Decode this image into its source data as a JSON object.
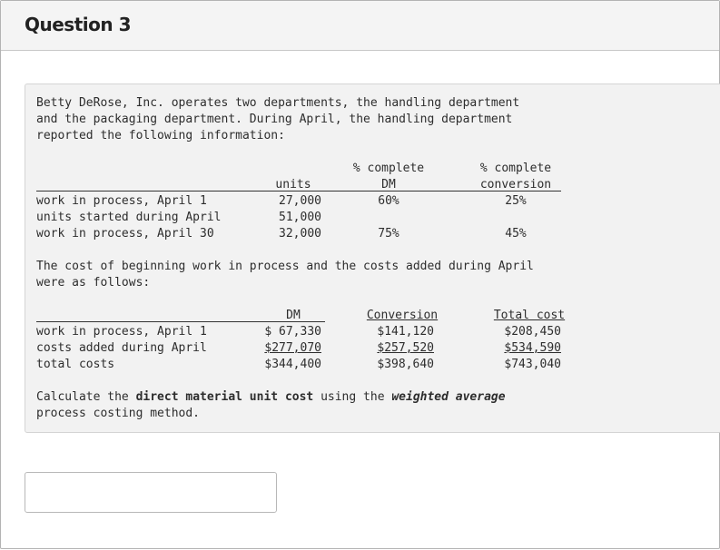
{
  "question": {
    "title": "Question 3"
  },
  "intro": [
    "Betty DeRose, Inc. operates two departments, the handling department",
    "and the packaging department. During April, the handling department",
    "reported the following information:"
  ],
  "units_table": {
    "headers": {
      "units": "units",
      "dm_top": "% complete",
      "dm_bottom": "DM",
      "conv_top": "% complete",
      "conv_bottom": "conversion"
    },
    "rows": [
      {
        "label": "work in process, April 1",
        "units": "27,000",
        "dm": "60%",
        "conv": "25%"
      },
      {
        "label": "units started during April",
        "units": "51,000",
        "dm": "",
        "conv": ""
      },
      {
        "label": "work in process, April 30",
        "units": "32,000",
        "dm": "75%",
        "conv": "45%"
      }
    ]
  },
  "cost_intro": [
    "The cost of beginning work in process and the costs added during April",
    "were as follows:"
  ],
  "cost_table": {
    "headers": {
      "dm": "DM",
      "conv": "Conversion",
      "total": "Total cost"
    },
    "rows": [
      {
        "label": "work in process, April 1",
        "dm": "$ 67,330",
        "conv": "$141,120",
        "total": "$208,450"
      },
      {
        "label": "costs added during April",
        "dm": "$277,070",
        "conv": "$257,520",
        "total": "$534,590"
      },
      {
        "label": "total costs",
        "dm": "$344,400",
        "conv": "$398,640",
        "total": "$743,040"
      }
    ]
  },
  "instruction": {
    "pre": "Calculate the ",
    "bold": "direct material unit cost",
    "mid": " using the ",
    "italic": "weighted average",
    "line2": "process costing method."
  },
  "answer": {
    "value": "",
    "placeholder": ""
  }
}
